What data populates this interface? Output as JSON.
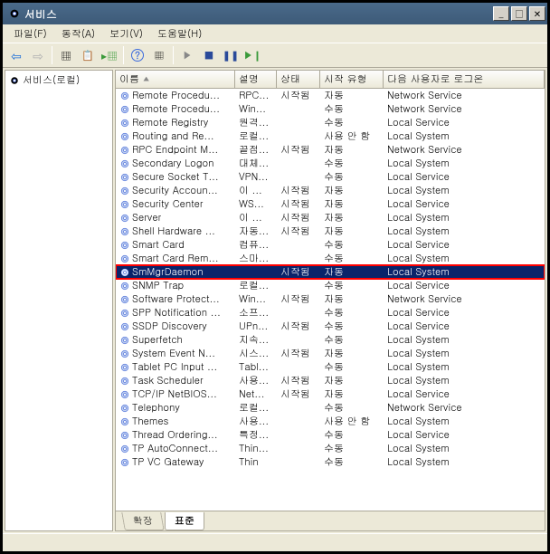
{
  "window": {
    "title": "서비스"
  },
  "menus": {
    "file": "파일(F)",
    "action": "동작(A)",
    "view": "보기(V)",
    "help": "도움말(H)"
  },
  "left_pane": {
    "root": "서비스(로컬)"
  },
  "columns": {
    "name": "이름",
    "desc": "설명",
    "status": "상태",
    "start_type": "시작 유형",
    "logon": "다음 사용자로 로그온"
  },
  "tabs": {
    "extended": "확장",
    "standard": "표준"
  },
  "selected_index": 13,
  "services": [
    {
      "name": "Remote Procedu...",
      "desc": "RPC...",
      "status": "시작됨",
      "start": "자동",
      "logon": "Network Service"
    },
    {
      "name": "Remote Procedu...",
      "desc": "Win...",
      "status": "",
      "start": "수동",
      "logon": "Network Service"
    },
    {
      "name": "Remote Registry",
      "desc": "원격...",
      "status": "",
      "start": "수동",
      "logon": "Local Service"
    },
    {
      "name": "Routing and Re...",
      "desc": "로컬...",
      "status": "",
      "start": "사용 안 함",
      "logon": "Local System"
    },
    {
      "name": "RPC Endpoint M...",
      "desc": "끝점...",
      "status": "시작됨",
      "start": "자동",
      "logon": "Network Service"
    },
    {
      "name": "Secondary Logon",
      "desc": "대체...",
      "status": "",
      "start": "수동",
      "logon": "Local System"
    },
    {
      "name": "Secure Socket T...",
      "desc": "VPN...",
      "status": "",
      "start": "수동",
      "logon": "Local Service"
    },
    {
      "name": "Security Accoun...",
      "desc": "이 ...",
      "status": "시작됨",
      "start": "자동",
      "logon": "Local System"
    },
    {
      "name": "Security Center",
      "desc": "WS...",
      "status": "시작됨",
      "start": "자동",
      "logon": "Local Service"
    },
    {
      "name": "Server",
      "desc": "이 ...",
      "status": "시작됨",
      "start": "자동",
      "logon": "Local System"
    },
    {
      "name": "Shell Hardware ...",
      "desc": "자동...",
      "status": "시작됨",
      "start": "자동",
      "logon": "Local System"
    },
    {
      "name": "Smart Card",
      "desc": "컴퓨...",
      "status": "",
      "start": "수동",
      "logon": "Local Service"
    },
    {
      "name": "Smart Card Rem...",
      "desc": "스마...",
      "status": "",
      "start": "수동",
      "logon": "Local System"
    },
    {
      "name": "SmMgrDaemon",
      "desc": "",
      "status": "시작됨",
      "start": "자동",
      "logon": "Local System"
    },
    {
      "name": "SNMP Trap",
      "desc": "로컬...",
      "status": "",
      "start": "수동",
      "logon": "Local Service"
    },
    {
      "name": "Software Protect...",
      "desc": "Win...",
      "status": "시작됨",
      "start": "자동",
      "logon": "Network Service"
    },
    {
      "name": "SPP Notification ...",
      "desc": "소프...",
      "status": "",
      "start": "수동",
      "logon": "Local Service"
    },
    {
      "name": "SSDP Discovery",
      "desc": "UPn...",
      "status": "시작됨",
      "start": "수동",
      "logon": "Local Service"
    },
    {
      "name": "Superfetch",
      "desc": "지속...",
      "status": "",
      "start": "수동",
      "logon": "Local System"
    },
    {
      "name": "System Event N...",
      "desc": "시스...",
      "status": "시작됨",
      "start": "자동",
      "logon": "Local System"
    },
    {
      "name": "Tablet PC Input ...",
      "desc": "Tabl...",
      "status": "",
      "start": "수동",
      "logon": "Local System"
    },
    {
      "name": "Task Scheduler",
      "desc": "사용...",
      "status": "시작됨",
      "start": "자동",
      "logon": "Local System"
    },
    {
      "name": "TCP/IP NetBIOS...",
      "desc": "Net...",
      "status": "시작됨",
      "start": "자동",
      "logon": "Local Service"
    },
    {
      "name": "Telephony",
      "desc": "로컬...",
      "status": "",
      "start": "수동",
      "logon": "Network Service"
    },
    {
      "name": "Themes",
      "desc": "사용...",
      "status": "",
      "start": "사용 안 함",
      "logon": "Local System"
    },
    {
      "name": "Thread Ordering...",
      "desc": "특정...",
      "status": "",
      "start": "수동",
      "logon": "Local Service"
    },
    {
      "name": "TP AutoConnect...",
      "desc": "Thin...",
      "status": "",
      "start": "수동",
      "logon": "Local System"
    },
    {
      "name": "TP VC Gateway",
      "desc": "Thin",
      "status": "",
      "start": "수동",
      "logon": "Local System"
    }
  ]
}
